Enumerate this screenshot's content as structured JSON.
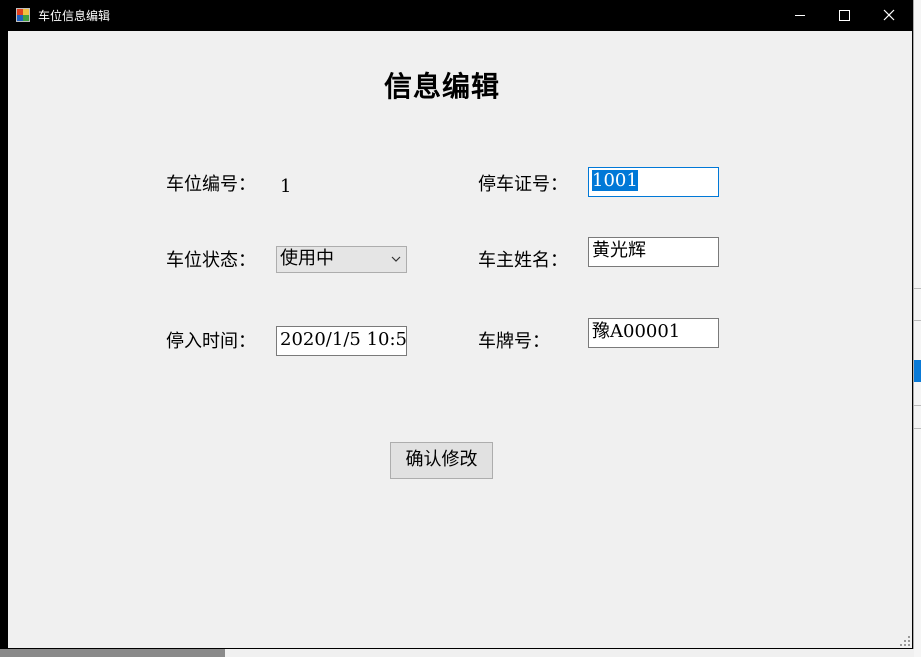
{
  "window": {
    "title": "车位信息编辑",
    "minimize": "−",
    "maximize": "□",
    "close": "✕"
  },
  "form": {
    "heading": "信息编辑",
    "space_no_label": "车位编号：",
    "space_no_value": "1",
    "permit_no_label": "停车证号：",
    "permit_no_value": "1001",
    "status_label": "车位状态：",
    "status_value": "使用中",
    "owner_label": "车主姓名：",
    "owner_value": "黄光辉",
    "entry_time_label": "停入时间：",
    "entry_time_value": "2020/1/5 10:5",
    "plate_label": "车牌号：",
    "plate_value": "豫A00001",
    "confirm_label": "确认修改"
  },
  "colors": {
    "titlebar": "#000000",
    "client": "#f0f0f0",
    "selection": "#0078d7"
  }
}
